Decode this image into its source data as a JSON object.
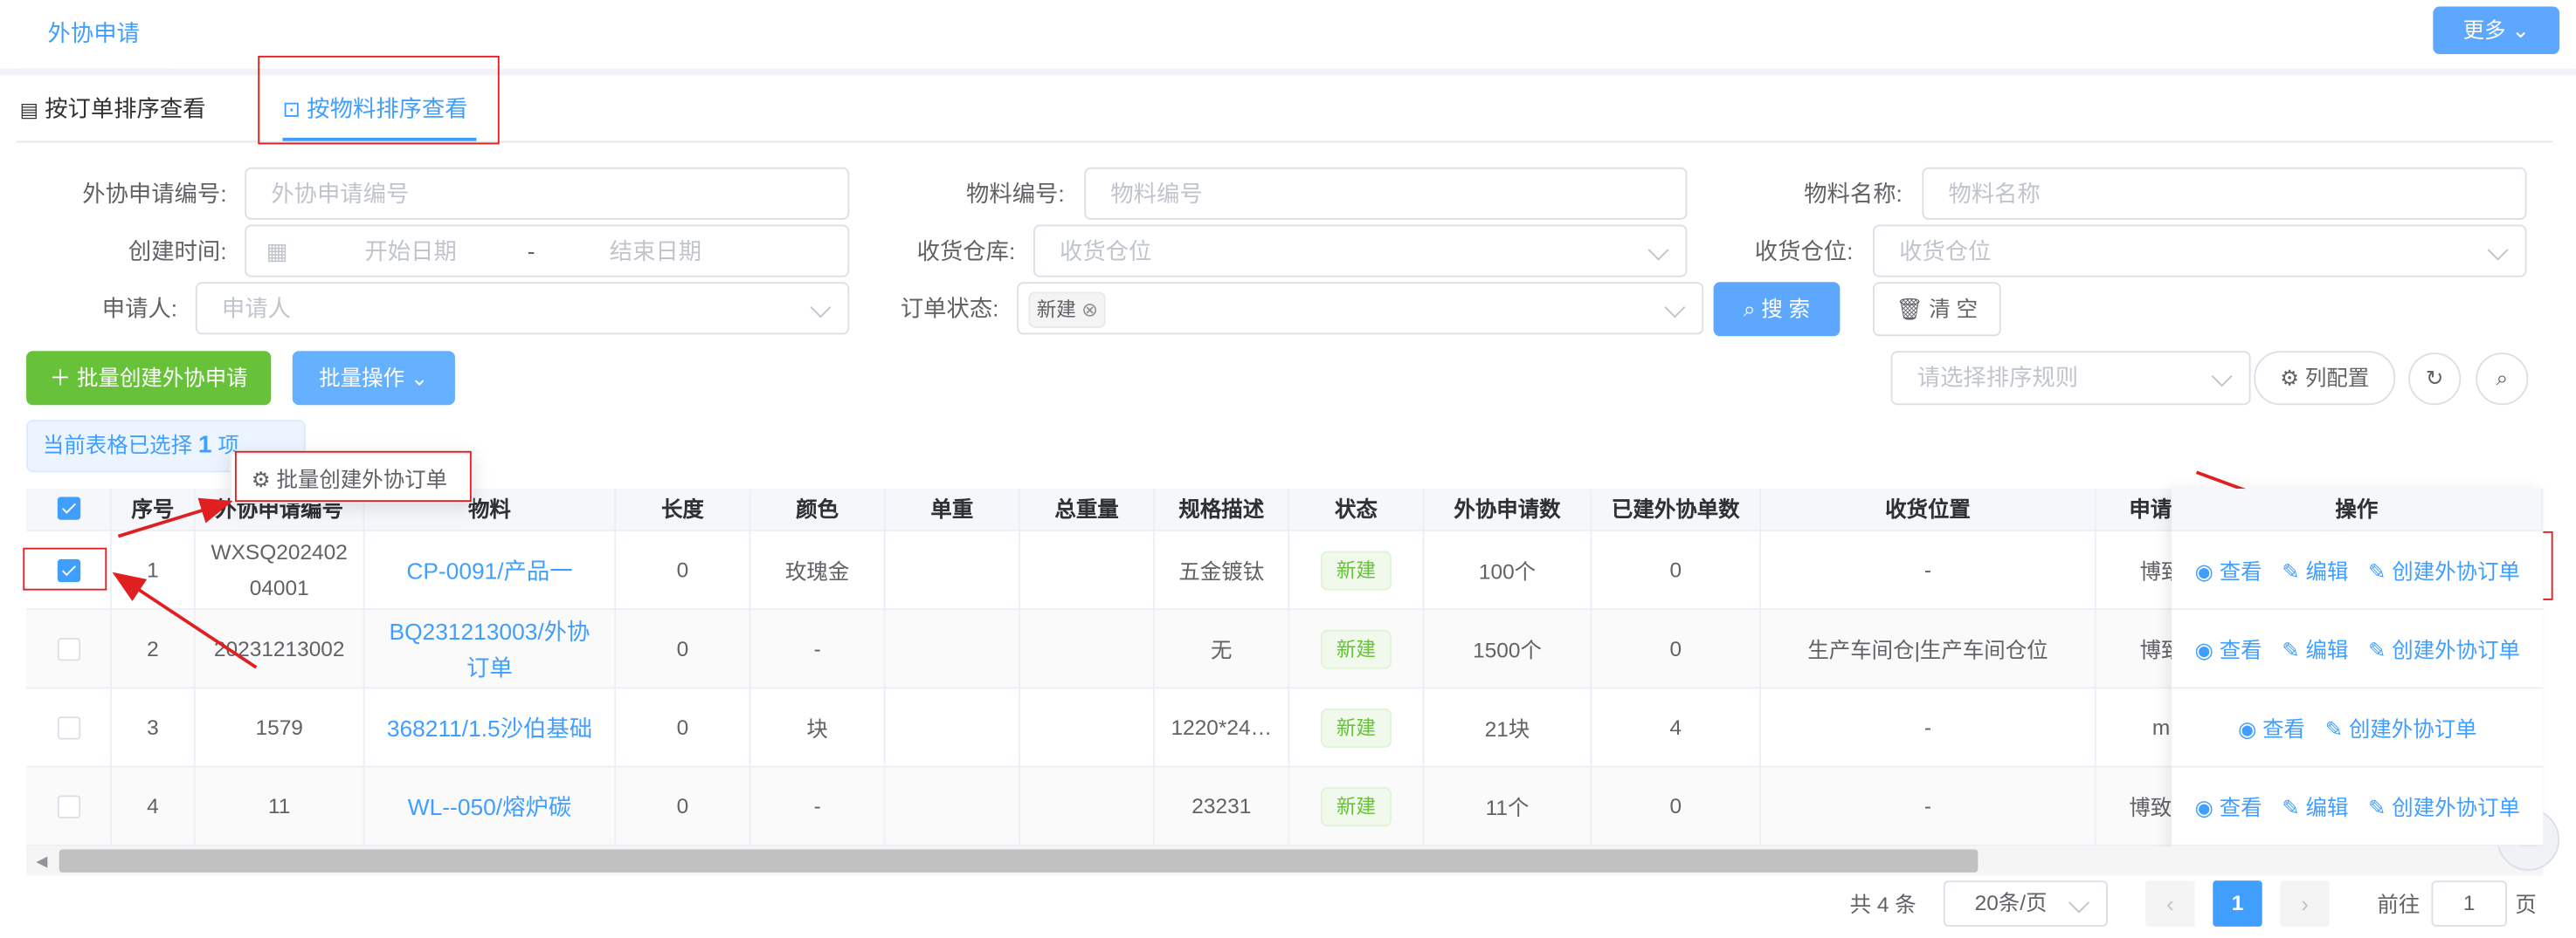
{
  "top_tab": "外协申请",
  "more_button": "更多",
  "subtabs": {
    "by_order": "按订单排序查看",
    "by_material": "按物料排序查看"
  },
  "filters": {
    "apply_no_label": "外协申请编号:",
    "apply_no_placeholder": "外协申请编号",
    "material_no_label": "物料编号:",
    "material_no_placeholder": "物料编号",
    "material_name_label": "物料名称:",
    "material_name_placeholder": "物料名称",
    "created_label": "创建时间:",
    "start_date": "开始日期",
    "date_sep": "-",
    "end_date": "结束日期",
    "warehouse_label": "收货仓库:",
    "warehouse_placeholder": "收货仓位",
    "location_label": "收货仓位:",
    "location_placeholder": "收货仓位",
    "applicant_label": "申请人:",
    "applicant_placeholder": "申请人",
    "status_label": "订单状态:",
    "status_tag": "新建",
    "search_button": "搜 索",
    "clear_button": "清 空"
  },
  "toolbar": {
    "batch_create": "批量创建外协申请",
    "batch_ops": "批量操作",
    "sort_placeholder": "请选择排序规则",
    "column_config": "列配置"
  },
  "selection": {
    "prefix": "当前表格已选择",
    "count": "1",
    "suffix": "项"
  },
  "dropdown_item": "批量创建外协订单",
  "table": {
    "headers": [
      "序号",
      "外协申请编号",
      "物料",
      "长度",
      "颜色",
      "单重",
      "总重量",
      "规格描述",
      "状态",
      "外协申请数",
      "已建外协单数",
      "收货位置",
      "申请人",
      "操作"
    ],
    "rows": [
      {
        "checked": true,
        "seq": "1",
        "apply_no": "WXSQ20240204001",
        "material": "CP-0091/产品一",
        "length": "0",
        "color": "玫瑰金",
        "unit_weight": "",
        "total_weight": "",
        "spec": "五金镀钛",
        "status": "新建",
        "apply_qty": "100个",
        "created_qty": "0",
        "location": "-",
        "applicant": "博致",
        "ops": [
          "查看",
          "编辑",
          "创建外协订单"
        ]
      },
      {
        "checked": false,
        "seq": "2",
        "apply_no": "20231213002",
        "material": "BQ231213003/外协订单",
        "length": "0",
        "color": "-",
        "unit_weight": "",
        "total_weight": "",
        "spec": "无",
        "status": "新建",
        "apply_qty": "1500个",
        "created_qty": "0",
        "location": "生产车间仓|生产车间仓位",
        "applicant": "博致",
        "ops": [
          "查看",
          "编辑",
          "创建外协订单"
        ]
      },
      {
        "checked": false,
        "seq": "3",
        "apply_no": "1579",
        "material": "368211/1.5沙伯基础",
        "length": "0",
        "color": "块",
        "unit_weight": "",
        "total_weight": "",
        "spec": "1220*24…",
        "status": "新建",
        "apply_qty": "21块",
        "created_qty": "4",
        "location": "-",
        "applicant": "m",
        "ops": [
          "查看",
          "创建外协订单"
        ]
      },
      {
        "checked": false,
        "seq": "4",
        "apply_no": "11",
        "material": "WL--050/熔炉碳",
        "length": "0",
        "color": "-",
        "unit_weight": "",
        "total_weight": "",
        "spec": "23231",
        "status": "新建",
        "apply_qty": "11个",
        "created_qty": "0",
        "location": "-",
        "applicant": "博致云",
        "ops": [
          "查看",
          "编辑",
          "创建外协订单"
        ]
      }
    ]
  },
  "pager": {
    "total": "共 4 条",
    "page_size": "20条/页",
    "current": "1",
    "goto": "前往",
    "goto_value": "1",
    "page_unit": "页"
  },
  "colors": {
    "primary": "#409eff",
    "success": "#67c23a",
    "annotation": "#e02020"
  }
}
